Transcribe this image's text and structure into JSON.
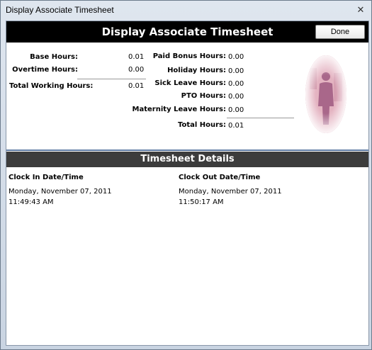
{
  "window": {
    "title": "Display Associate Timesheet",
    "close_glyph": "✕"
  },
  "header": {
    "title": "Display Associate Timesheet",
    "done_label": "Done"
  },
  "left_summary": {
    "base_hours_label": "Base Hours:",
    "base_hours_value": "0.01",
    "overtime_hours_label": "Overtime Hours:",
    "overtime_hours_value": "0.00",
    "total_working_hours_label": "Total Working Hours:",
    "total_working_hours_value": "0.01"
  },
  "right_summary": {
    "paid_bonus_label": "Paid Bonus Hours:",
    "paid_bonus_value": "0.00",
    "holiday_label": "Holiday Hours:",
    "holiday_value": "0.00",
    "sick_leave_label": "Sick Leave Hours:",
    "sick_leave_value": "0.00",
    "pto_label": "PTO Hours:",
    "pto_value": "0.00",
    "maternity_label": "Maternity Leave Hours:",
    "maternity_value": "0.00",
    "total_hours_label": "Total Hours:",
    "total_hours_value": "0.01"
  },
  "details": {
    "title": "Timesheet Details",
    "clock_in_header": "Clock In Date/Time",
    "clock_out_header": "Clock Out Date/Time",
    "clock_in_date": "Monday, November 07, 2011",
    "clock_in_time": "11:49:43 AM",
    "clock_out_date": "Monday, November 07, 2011",
    "clock_out_time": "11:50:17 AM"
  },
  "icons": {
    "avatar": "business-person-silhouette-image",
    "close": "close-icon"
  },
  "colors": {
    "header_bg": "#000000",
    "details_bar_bg": "#3c3c3c",
    "divider": "#5f7ca5"
  }
}
